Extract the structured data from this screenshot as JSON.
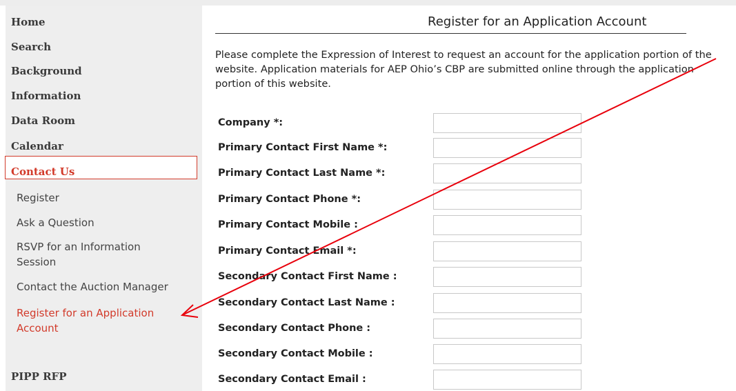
{
  "sidebar": {
    "main_items": [
      {
        "label": "Home"
      },
      {
        "label": "Search"
      },
      {
        "label": "Background"
      },
      {
        "label": "Information"
      },
      {
        "label": "Data Room"
      },
      {
        "label": "Calendar"
      },
      {
        "label": "Contact Us"
      },
      {
        "label": "PIPP RFP"
      }
    ],
    "sub_items": [
      {
        "label": "Register"
      },
      {
        "label": "Ask a Question"
      },
      {
        "label": "RSVP for an Information Session"
      },
      {
        "label": "Contact the Auction Manager"
      },
      {
        "label": "Register for an Application Account"
      }
    ]
  },
  "page": {
    "title": "Register for an Application Account",
    "intro": "Please complete the Expression of Interest to request an account for the application portion of the website. Application materials for AEP Ohio’s CBP are submitted online through the application portion of this website."
  },
  "form": {
    "fields": [
      {
        "label": "Company *:",
        "value": ""
      },
      {
        "label": "Primary Contact First Name *:",
        "value": ""
      },
      {
        "label": "Primary Contact Last Name *:",
        "value": ""
      },
      {
        "label": "Primary Contact Phone *:",
        "value": ""
      },
      {
        "label": "Primary Contact Mobile :",
        "value": ""
      },
      {
        "label": "Primary Contact Email *:",
        "value": ""
      },
      {
        "label": "Secondary Contact First Name :",
        "value": ""
      },
      {
        "label": "Secondary Contact Last Name :",
        "value": ""
      },
      {
        "label": "Secondary Contact Phone :",
        "value": ""
      },
      {
        "label": "Secondary Contact Mobile :",
        "value": ""
      },
      {
        "label": "Secondary Contact Email :",
        "value": ""
      }
    ]
  },
  "colors": {
    "accent": "#d23a2a",
    "annotation_arrow": "#e8000b",
    "sidebar_bg": "#eeeeee"
  }
}
